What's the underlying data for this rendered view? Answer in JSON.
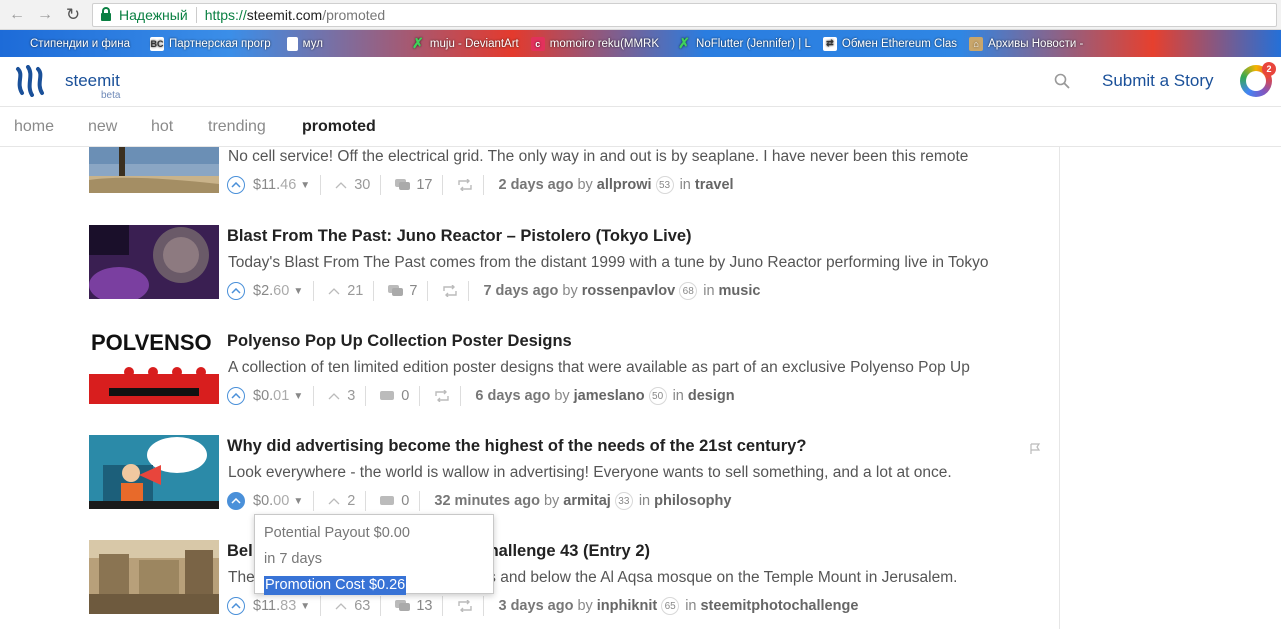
{
  "browser": {
    "secure_label": "Надежный",
    "url_scheme": "https://",
    "url_host": "steemit.com",
    "url_path": "/promoted",
    "bookmarks": [
      {
        "label": "Стипендии и фина",
        "icon": "bookmark-icon"
      },
      {
        "label": "Партнерская прогр",
        "icon": "bc-icon"
      },
      {
        "label": "мул",
        "icon": "page-icon"
      },
      {
        "label": "muju - DeviantArt",
        "icon": "deviantart-icon"
      },
      {
        "label": "momoiro reku(MMRK",
        "icon": "c-icon"
      },
      {
        "label": "NoFlutter (Jennifer) | L",
        "icon": "deviantart-icon"
      },
      {
        "label": "Обмен Ethereum Clas",
        "icon": "exchange-icon"
      },
      {
        "label": "Архивы Новости -",
        "icon": "house-icon"
      }
    ]
  },
  "header": {
    "brand": "steemit",
    "beta": "beta",
    "submit_label": "Submit a Story",
    "notification_count": "2"
  },
  "nav": {
    "tabs": [
      {
        "label": "home",
        "active": false
      },
      {
        "label": "new",
        "active": false
      },
      {
        "label": "trending",
        "active": false
      },
      {
        "label": "hot",
        "active": false
      },
      {
        "label": "promoted",
        "active": true
      }
    ]
  },
  "posts": [
    {
      "title": "",
      "body": "No cell service! Off the electrical grid. The only way in and out is by seaplane. I have never been this remote",
      "payout_whole": "$11.",
      "payout_frac": "46",
      "votes": "30",
      "comments": "17",
      "age": "2 days ago",
      "by": "by",
      "author": "allprowi",
      "rep": "53",
      "in": "in",
      "category": "travel"
    },
    {
      "title": "Blast From The Past: Juno Reactor – Pistolero (Tokyo Live)",
      "body": "Today's Blast From The Past comes from the distant 1999 with a tune by Juno Reactor performing live in Tokyo",
      "payout_whole": "$2.",
      "payout_frac": "60",
      "votes": "21",
      "comments": "7",
      "age": "7 days ago",
      "by": "by",
      "author": "rossenpavlov",
      "rep": "68",
      "in": "in",
      "category": "music"
    },
    {
      "title": "Polyenso Pop Up Collection Poster Designs",
      "body": "A collection of ten limited edition poster designs that were available as part of an exclusive Polyenso Pop Up",
      "payout_whole": "$0.",
      "payout_frac": "01",
      "votes": "3",
      "comments": "0",
      "age": "6 days ago",
      "by": "by",
      "author": "jameslano",
      "rep": "50",
      "in": "in",
      "category": "design"
    },
    {
      "title": "Why did advertising become the highest of the needs of the 21st century?",
      "body": "Look everywhere - the world is wallow in advertising! Everyone wants to sell something, and a lot at once.",
      "payout_whole": "$0.",
      "payout_frac": "00",
      "votes": "2",
      "comments": "0",
      "age": "32 minutes ago",
      "by": "by",
      "author": "armitaj",
      "rep": "33",
      "in": "in",
      "category": "philosophy"
    },
    {
      "title_start": "Bel",
      "title_end": "Challenge 43 (Entry 2)",
      "body_start": "The",
      "body_end": "ls and below the Al Aqsa mosque on the Temple Mount in Jerusalem.",
      "payout_whole": "$11.",
      "payout_frac": "83",
      "votes": "63",
      "comments": "13",
      "age": "3 days ago",
      "by": "by",
      "author": "inphiknit",
      "rep": "65",
      "in": "in",
      "category": "steemitphotochallenge"
    }
  ],
  "popup": {
    "line1": "Potential Payout $0.00",
    "line2": "in 7 days",
    "line3": "Promotion Cost $0.26"
  },
  "colors": {
    "brand": "#1a5099",
    "vote": "#4a90d9",
    "selection": "#3873d6"
  }
}
